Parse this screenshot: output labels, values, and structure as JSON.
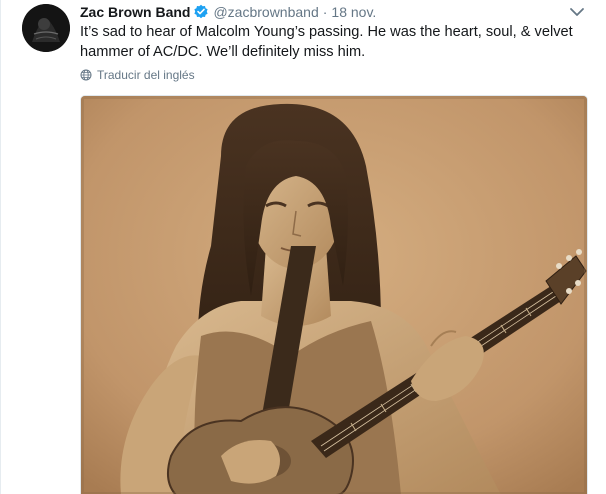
{
  "tweet": {
    "author_name": "Zac Brown Band",
    "handle": "@zacbrownband",
    "separator": "·",
    "date": "18 nov.",
    "text": "It’s sad to hear of Malcolm Young’s passing. He was the heart, soul, & velvet hammer of AC/DC. We’ll definitely miss him.",
    "translate_label": "Traducir del inglés",
    "icons": {
      "verified": "verified-badge-icon",
      "caret": "chevron-down-icon",
      "translate": "globe-icon"
    }
  },
  "colors": {
    "name": "#14171a",
    "secondary": "#657786",
    "verified": "#1da1f2",
    "photo_sepia": "#c49a6c"
  }
}
